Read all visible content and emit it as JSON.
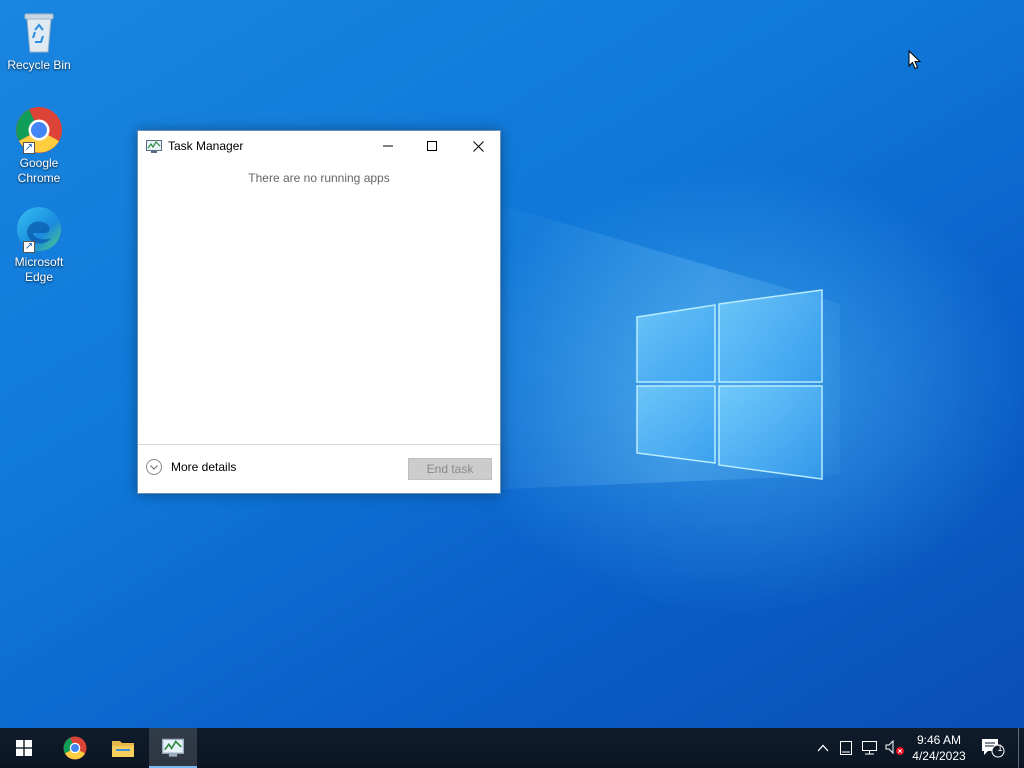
{
  "desktop": {
    "icons": [
      {
        "label": "Recycle Bin"
      },
      {
        "label_line1": "Google",
        "label_line2": "Chrome"
      },
      {
        "label_line1": "Microsoft",
        "label_line2": "Edge"
      }
    ]
  },
  "task_manager": {
    "title": "Task Manager",
    "empty_message": "There are no running apps",
    "more_details_label": "More details",
    "end_task_label": "End task",
    "end_task_enabled": false
  },
  "taskbar": {
    "pinned": [
      "start-icon",
      "chrome-icon",
      "file-explorer-icon",
      "task-manager-icon"
    ],
    "active": "task-manager-icon"
  },
  "tray": {
    "time": "9:46 AM",
    "date": "4/24/2023",
    "notification_count": "1",
    "volume_muted": true
  },
  "colors": {
    "desktop_bg": "#0f78d8",
    "taskbar_bg": "#0e1a2a",
    "active_task_underline": "#7cb8ee"
  }
}
